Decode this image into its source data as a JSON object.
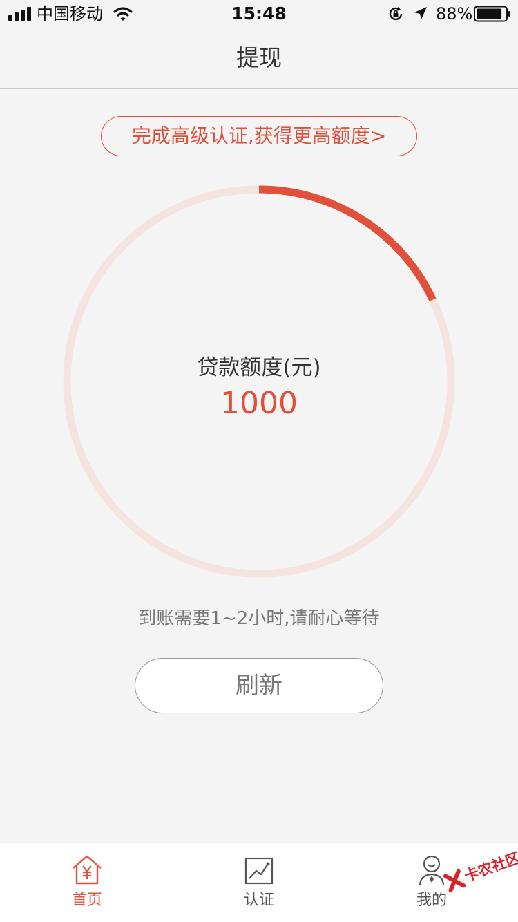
{
  "status_bar": {
    "carrier": "中国移动",
    "time": "15:48",
    "battery_percent": "88%",
    "battery_level": 0.88,
    "icons": [
      "signal-icon",
      "wifi-icon",
      "orientation-lock-icon",
      "location-arrow-icon",
      "battery-icon"
    ]
  },
  "nav": {
    "title": "提现"
  },
  "upgrade_banner": {
    "text": "完成高级认证,获得更高额度>"
  },
  "gauge": {
    "label": "贷款额度(元)",
    "value": "1000",
    "progress_fraction": 0.18,
    "track_color": "#f4e3df",
    "progress_color": "#e0503a"
  },
  "wait_text": "到账需要1~2小时,请耐心等待",
  "refresh_button": "刷新",
  "tabs": [
    {
      "label": "首页",
      "icon": "home-yuan-icon",
      "active": true
    },
    {
      "label": "认证",
      "icon": "chart-trend-icon",
      "active": false
    },
    {
      "label": "我的",
      "icon": "user-icon",
      "active": false
    }
  ],
  "watermark": {
    "text": "卡农社区"
  },
  "colors": {
    "accent": "#e0503a",
    "background": "#f4f4f4",
    "tab_inactive": "#555555"
  }
}
